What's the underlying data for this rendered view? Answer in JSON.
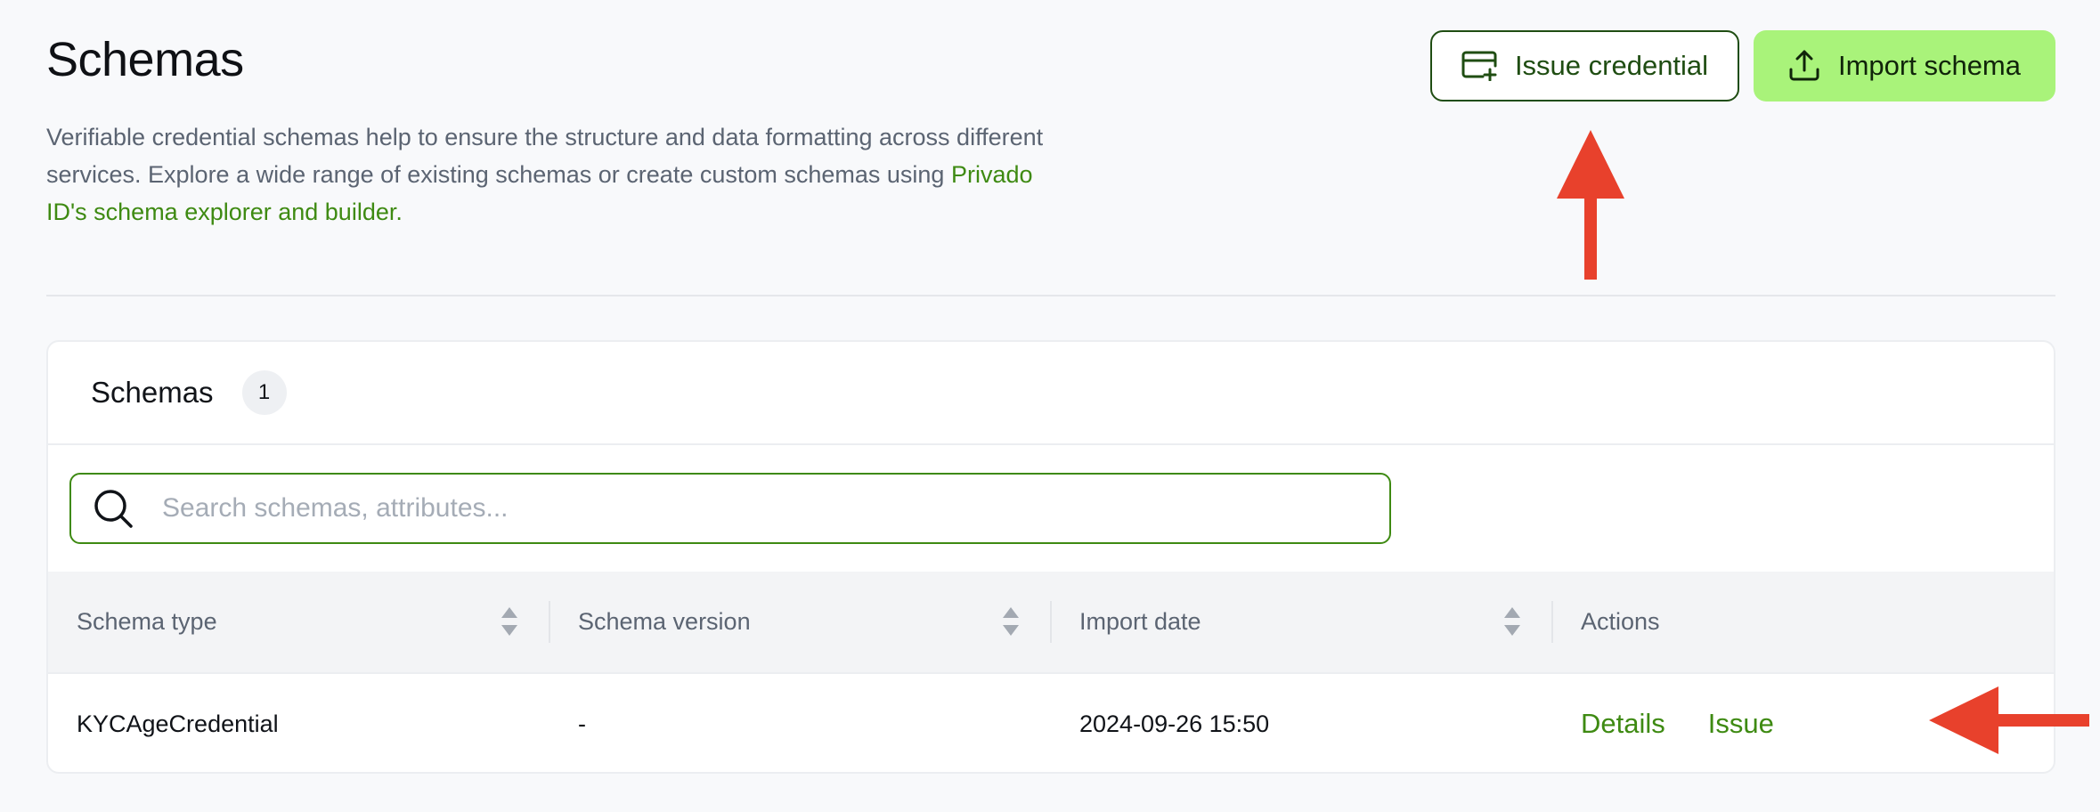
{
  "header": {
    "title": "Schemas",
    "description_prefix": "Verifiable credential schemas help to ensure the structure and data formatting across different services. Explore a wide range of existing schemas or create custom schemas using ",
    "description_link": "Privado ID's schema explorer and builder."
  },
  "buttons": {
    "issue_credential": "Issue credential",
    "import_schema": "Import schema"
  },
  "card": {
    "title": "Schemas",
    "count": "1"
  },
  "search": {
    "placeholder": "Search schemas, attributes..."
  },
  "table": {
    "columns": [
      "Schema type",
      "Schema version",
      "Import date",
      "Actions"
    ],
    "rows": [
      {
        "schema_type": "KYCAgeCredential",
        "schema_version": "-",
        "import_date": "2024-09-26 15:50",
        "action_details": "Details",
        "action_issue": "Issue"
      }
    ]
  },
  "colors": {
    "accent_green": "#3e8a12",
    "import_button_bg": "#a9f37a",
    "annotation_arrow": "#e8412c"
  },
  "icons": {
    "issue_credential": "credential-add-icon",
    "import_schema": "upload-icon",
    "search": "search-icon",
    "sort": "sort-icon"
  }
}
